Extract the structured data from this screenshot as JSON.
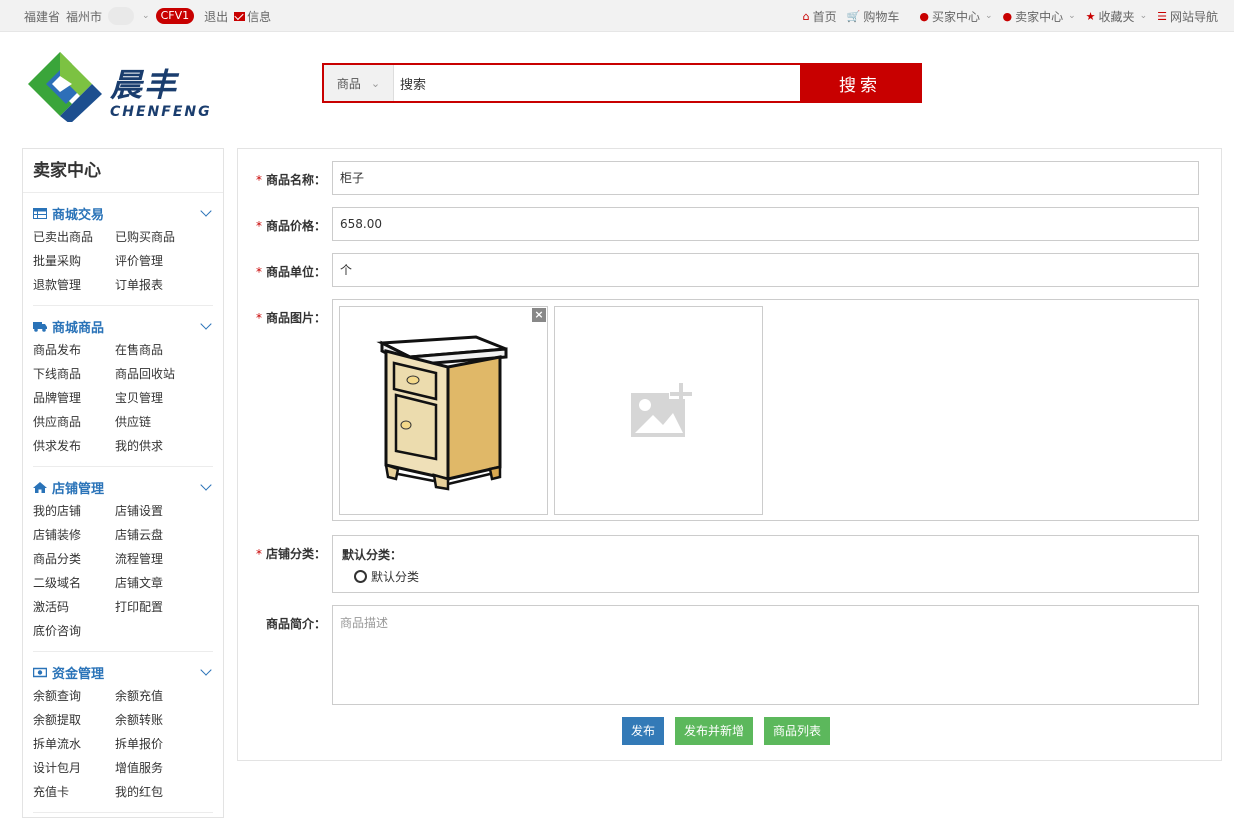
{
  "topbar": {
    "province": "福建省",
    "city": "福州市",
    "badge": "CFV1",
    "logout": "退出",
    "messages": "信息",
    "nav": [
      {
        "label": "首页",
        "icon": "home-icon",
        "dropdown": false
      },
      {
        "label": "购物车",
        "icon": "cart-icon",
        "dropdown": false
      },
      {
        "label": "买家中心",
        "icon": "user-icon",
        "dropdown": true
      },
      {
        "label": "卖家中心",
        "icon": "user-icon",
        "dropdown": true
      },
      {
        "label": "收藏夹",
        "icon": "star-icon",
        "dropdown": true
      },
      {
        "label": "网站导航",
        "icon": "list-icon",
        "dropdown": false
      }
    ]
  },
  "logo": {
    "cn": "晨丰",
    "en": "CHENFENG"
  },
  "search": {
    "scope": "商品",
    "value": "搜索",
    "button": "搜索"
  },
  "sidebar": {
    "title": "卖家中心",
    "groups": [
      {
        "title": "商城交易",
        "icon": "table-icon",
        "items": [
          "已卖出商品",
          "已购买商品",
          "批量采购",
          "评价管理",
          "退款管理",
          "订单报表"
        ]
      },
      {
        "title": "商城商品",
        "icon": "truck-icon",
        "items": [
          "商品发布",
          "在售商品",
          "下线商品",
          "商品回收站",
          "品牌管理",
          "宝贝管理",
          "供应商品",
          "供应链",
          "供求发布",
          "我的供求"
        ]
      },
      {
        "title": "店铺管理",
        "icon": "home-icon",
        "items": [
          "我的店铺",
          "店铺设置",
          "店铺装修",
          "店铺云盘",
          "商品分类",
          "流程管理",
          "二级域名",
          "店铺文章",
          "激活码",
          "打印配置",
          "底价咨询"
        ]
      },
      {
        "title": "资金管理",
        "icon": "money-icon",
        "items": [
          "余额查询",
          "余额充值",
          "余额提取",
          "余额转账",
          "拆单流水",
          "拆单报价",
          "设计包月",
          "增值服务",
          "充值卡",
          "我的红包"
        ]
      }
    ]
  },
  "form": {
    "name_label": "商品名称：",
    "name_value": "柜子",
    "price_label": "商品价格：",
    "price_value": "658.00",
    "unit_label": "商品单位：",
    "unit_value": "个",
    "image_label": "商品图片：",
    "category_label": "店铺分类：",
    "category_title": "默认分类：",
    "category_option": "默认分类",
    "desc_label": "商品简介：",
    "desc_placeholder": "商品描述",
    "required_mark": "*"
  },
  "buttons": {
    "publish": "发布",
    "publish_new": "发布并新增",
    "list": "商品列表"
  },
  "colors": {
    "brand_red": "#c80000",
    "link_blue": "#2a73b8",
    "btn_blue": "#337ab7",
    "btn_green": "#5cb85c"
  }
}
